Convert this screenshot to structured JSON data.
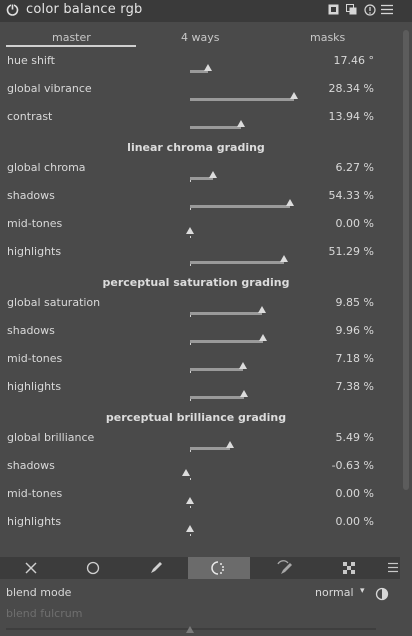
{
  "module": {
    "title": "color balance rgb",
    "icons": [
      "presets-icon",
      "multi-instance-icon",
      "reset-icon",
      "menu-icon"
    ]
  },
  "tabs": [
    {
      "label": "master",
      "active": true
    },
    {
      "label": "4 ways",
      "active": false
    },
    {
      "label": "masks",
      "active": false
    }
  ],
  "sliders": {
    "hue_shift": {
      "label": "hue shift",
      "value": "17.46 °",
      "level": 0.55
    },
    "global_vibrance": {
      "label": "global vibrance",
      "value": "28.34 %",
      "level": 0.28
    },
    "contrast": {
      "label": "contrast",
      "value": "13.94 %",
      "level": 0.14
    }
  },
  "linear_chroma": {
    "heading": "linear chroma grading",
    "global_chroma": {
      "label": "global chroma",
      "value": "6.27 %",
      "level": 0.06
    },
    "shadows": {
      "label": "shadows",
      "value": "54.33 %",
      "level": 0.54
    },
    "midtones": {
      "label": "mid-tones",
      "value": "0.00 %",
      "level": 0.0
    },
    "highlights": {
      "label": "highlights",
      "value": "51.29 %",
      "level": 0.51
    }
  },
  "perceptual_saturation": {
    "heading": "perceptual saturation grading",
    "global_saturation": {
      "label": "global saturation",
      "value": "9.85 %",
      "level": 0.1
    },
    "shadows": {
      "label": "shadows",
      "value": "9.96 %",
      "level": 0.1
    },
    "midtones": {
      "label": "mid-tones",
      "value": "7.18 %",
      "level": 0.07
    },
    "highlights": {
      "label": "highlights",
      "value": "7.38 %",
      "level": 0.07
    }
  },
  "perceptual_brilliance": {
    "heading": "perceptual brilliance grading",
    "global_brilliance": {
      "label": "global brilliance",
      "value": "5.49 %",
      "level": 0.05
    },
    "shadows": {
      "label": "shadows",
      "value": "-0.63 %",
      "level": -0.006
    },
    "midtones": {
      "label": "mid-tones",
      "value": "0.00 %",
      "level": 0.0
    },
    "highlights": {
      "label": "highlights",
      "value": "0.00 %",
      "level": 0.0
    }
  },
  "mask_toolbar": {
    "buttons": [
      "off-icon",
      "uniform-icon",
      "drawn-icon",
      "parametric-icon",
      "drawn-parametric-icon",
      "raster-icon"
    ],
    "active": "parametric-icon"
  },
  "blend": {
    "mode_label": "blend mode",
    "mode_value": "normal",
    "fulcrum_label": "blend fulcrum"
  },
  "colors": {
    "background": "#4a4a4a",
    "header": "#3a3a3a",
    "text": "#d9d9d9",
    "slider_fill": "#9a9a9a",
    "active_button": "#6b6b6b"
  }
}
